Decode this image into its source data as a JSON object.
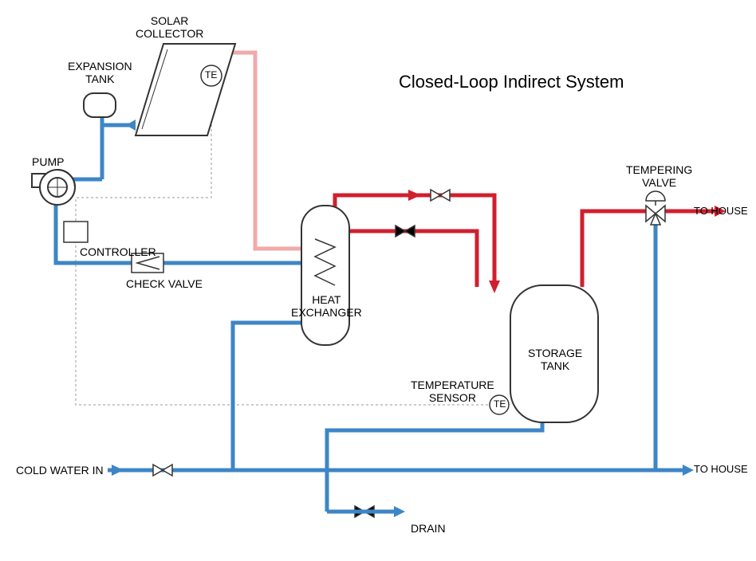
{
  "title": "Closed-Loop Indirect System",
  "labels": {
    "solar_collector": "SOLAR\nCOLLECTOR",
    "expansion_tank": "EXPANSION\nTANK",
    "pump": "PUMP",
    "controller": "CONTROLLER",
    "check_valve": "CHECK VALVE",
    "heat_exchanger": "HEAT\nEXCHANGER",
    "temperature_sensor": "TEMPERATURE\nSENSOR",
    "storage_tank": "STORAGE\nTANK",
    "tempering_valve": "TEMPERING\nVALVE",
    "te1": "TE",
    "te2": "TE",
    "cold_water_in": "COLD WATER IN",
    "to_house_top": "TO HOUSE",
    "to_house_bottom": "TO HOUSE",
    "drain": "DRAIN"
  },
  "colors": {
    "cold": "#3d86c6",
    "hot": "#d11f2e",
    "warm": "#f2a9a9",
    "thin": "#333333",
    "dash": "#999999"
  }
}
